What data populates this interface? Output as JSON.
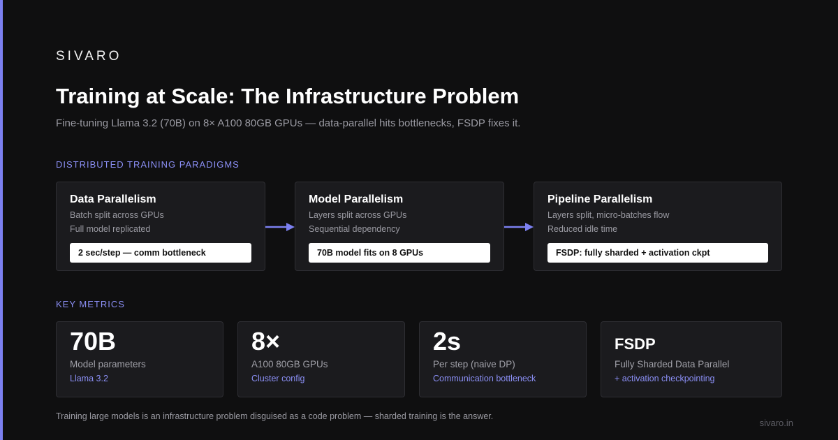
{
  "brand": "SIVARO",
  "title": "Training at Scale: The Infrastructure Problem",
  "subtitle": "Fine-tuning Llama 3.2 (70B) on 8× A100 80GB GPUs — data-parallel hits bottlenecks, FSDP fixes it.",
  "sections": {
    "paradigms_label": "DISTRIBUTED TRAINING PARADIGMS",
    "metrics_label": "KEY METRICS"
  },
  "paradigms": [
    {
      "title": "Data Parallelism",
      "line1": "Batch split across GPUs",
      "line2": "Full model replicated",
      "chip": "2 sec/step — comm bottleneck"
    },
    {
      "title": "Model Parallelism",
      "line1": "Layers split across GPUs",
      "line2": "Sequential dependency",
      "chip": "70B model fits on 8 GPUs"
    },
    {
      "title": "Pipeline Parallelism",
      "line1": "Layers split, micro-batches flow",
      "line2": "Reduced idle time",
      "chip": "FSDP: fully sharded + activation ckpt"
    }
  ],
  "metrics": [
    {
      "value": "70B",
      "label": "Model parameters",
      "sub": "Llama 3.2"
    },
    {
      "value": "8×",
      "label": "A100 80GB GPUs",
      "sub": "Cluster config"
    },
    {
      "value": "2s",
      "label": "Per step (naive DP)",
      "sub": "Communication bottleneck"
    },
    {
      "value": "FSDP",
      "label": "Fully Sharded Data Parallel",
      "sub": "+ activation checkpointing"
    }
  ],
  "footer": "Training large models is an infrastructure problem disguised as a code problem — sharded training is the answer.",
  "domain": "sivaro.in",
  "icons": {
    "flow_arrow": "arrow-right-icon"
  },
  "colors": {
    "background": "#0f0f10",
    "accent": "#7c80f0",
    "card": "#1b1b1e",
    "card_border": "#2e2e33",
    "muted_text": "#9a9aa2",
    "chip_bg": "#ffffff"
  }
}
